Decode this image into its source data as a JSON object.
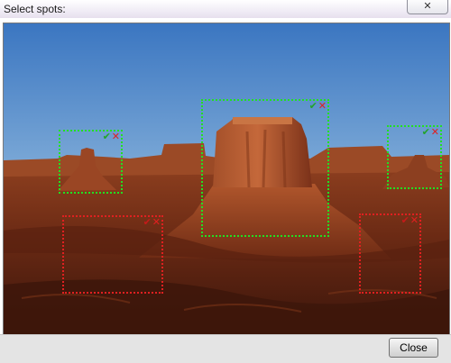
{
  "window": {
    "title": "Select spots:",
    "close_glyph": "✕"
  },
  "spots": [
    {
      "id": "spot-1",
      "status": "accepted"
    },
    {
      "id": "spot-2",
      "status": "accepted"
    },
    {
      "id": "spot-3",
      "status": "accepted"
    },
    {
      "id": "spot-4",
      "status": "rejected"
    },
    {
      "id": "spot-5",
      "status": "rejected"
    }
  ],
  "spot_icons": {
    "accept": "✔",
    "reject": "✕"
  },
  "colors": {
    "accepted_border": "#22e022",
    "rejected_border": "#e02020"
  },
  "footer": {
    "close_label": "Close"
  }
}
